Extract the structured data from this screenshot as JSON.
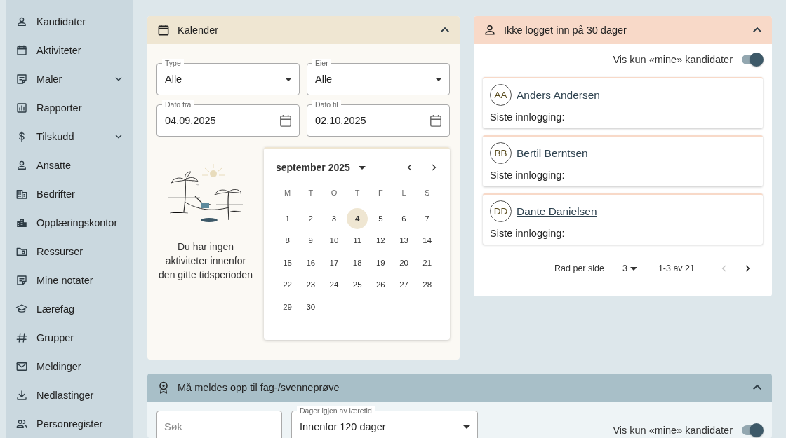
{
  "sidebar": {
    "items": [
      {
        "label": "Kandidater"
      },
      {
        "label": "Aktiviteter"
      },
      {
        "label": "Maler",
        "expanded": false
      },
      {
        "label": "Rapporter"
      },
      {
        "label": "Tilskudd",
        "expanded": false
      },
      {
        "label": "Ansatte"
      },
      {
        "label": "Bedrifter"
      },
      {
        "label": "Opplæringskontor"
      },
      {
        "label": "Ressurser"
      },
      {
        "label": "Mine notater"
      },
      {
        "label": "Lærefag"
      },
      {
        "label": "Grupper"
      },
      {
        "label": "Meldinger"
      },
      {
        "label": "Nedlastinger"
      },
      {
        "label": "Personregister"
      }
    ]
  },
  "calendar_panel": {
    "title": "Kalender",
    "expanded": true,
    "filters": [
      {
        "kind": "select",
        "label": "Type",
        "value": "Alle"
      },
      {
        "kind": "select",
        "label": "Eier",
        "value": "Alle"
      },
      {
        "kind": "date",
        "label": "Dato fra",
        "value": "04.09.2025"
      },
      {
        "kind": "date",
        "label": "Dato til",
        "value": "02.10.2025"
      }
    ],
    "empty_message": "Du har ingen aktiviteter innenfor den gitte tidsperioden",
    "month_picker": {
      "month": "september 2025",
      "weekdays": [
        "M",
        "T",
        "O",
        "T",
        "F",
        "L",
        "S"
      ],
      "days": [
        {
          "label": "1",
          "selected": false
        },
        {
          "label": "2",
          "selected": false
        },
        {
          "label": "3",
          "selected": false
        },
        {
          "label": "4",
          "selected": true
        },
        {
          "label": "5",
          "selected": false
        },
        {
          "label": "6",
          "selected": false
        },
        {
          "label": "7",
          "selected": false
        },
        {
          "label": "8",
          "selected": false
        },
        {
          "label": "9",
          "selected": false
        },
        {
          "label": "10",
          "selected": false
        },
        {
          "label": "11",
          "selected": false
        },
        {
          "label": "12",
          "selected": false
        },
        {
          "label": "13",
          "selected": false
        },
        {
          "label": "14",
          "selected": false
        },
        {
          "label": "15",
          "selected": false
        },
        {
          "label": "16",
          "selected": false
        },
        {
          "label": "17",
          "selected": false
        },
        {
          "label": "18",
          "selected": false
        },
        {
          "label": "19",
          "selected": false
        },
        {
          "label": "20",
          "selected": false
        },
        {
          "label": "21",
          "selected": false
        },
        {
          "label": "22",
          "selected": false
        },
        {
          "label": "23",
          "selected": false
        },
        {
          "label": "24",
          "selected": false
        },
        {
          "label": "25",
          "selected": false
        },
        {
          "label": "26",
          "selected": false
        },
        {
          "label": "27",
          "selected": false
        },
        {
          "label": "28",
          "selected": false
        },
        {
          "label": "29",
          "selected": false
        },
        {
          "label": "30",
          "selected": false
        }
      ]
    }
  },
  "inactive_panel": {
    "title": "Ikke logget inn på 30 dager",
    "expanded": true,
    "toggle": {
      "label": "Vis kun «mine» kandidater",
      "on": true
    },
    "candidates": [
      {
        "initials": "AA",
        "name": "Anders Andersen",
        "last_login_label": "Siste innlogging:"
      },
      {
        "initials": "BB",
        "name": "Bertil Berntsen",
        "last_login_label": "Siste innlogging:"
      },
      {
        "initials": "DD",
        "name": "Dante Danielsen",
        "last_login_label": "Siste innlogging:"
      }
    ],
    "pagination": {
      "rows_per_page_label": "Rad per side",
      "rows_per_page": "3",
      "range": "1-3 av 21",
      "previous_disabled": true,
      "next_disabled": false
    }
  },
  "exam_panel": {
    "title": "Må meldes opp til fag-/svenneprøve",
    "expanded": true,
    "search": {
      "placeholder": "Søk"
    },
    "days_select": {
      "label": "Dager igjen av læretid",
      "value": "Innenfor 120 dager"
    },
    "toggle": {
      "label": "Vis kun «mine» kandidater",
      "on": true
    }
  }
}
